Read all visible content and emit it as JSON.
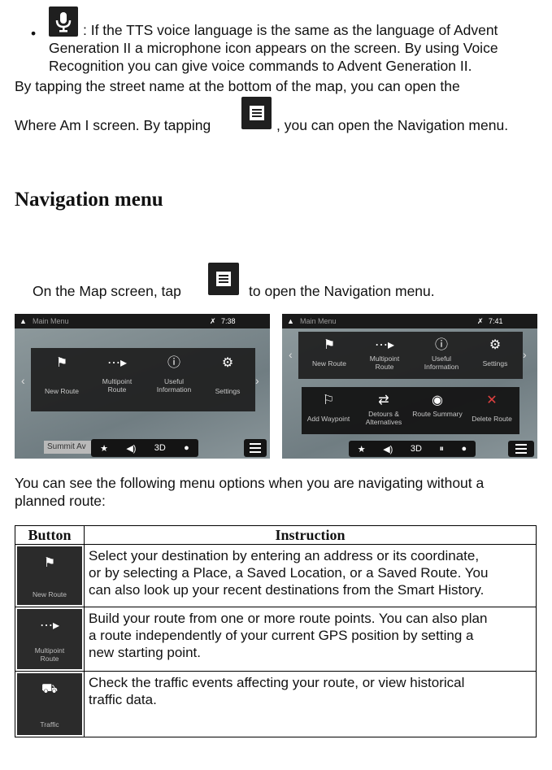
{
  "intro": {
    "bullet": "•",
    "mic_line1": ": If the TTS voice language is the same as the language of Advent",
    "mic_line2": "Generation II a microphone icon appears on the screen. By using Voice",
    "mic_line3": "Recognition you can give voice commands to Advent Generation II.",
    "street_line1": "By tapping the street name at the bottom of the map, you can open the",
    "street_line2a": "Where Am I screen. By tapping",
    "street_line2b": ", you can open the Navigation menu."
  },
  "section_title": "Navigation menu",
  "map_instruction_a": "On the Map screen, tap",
  "map_instruction_b": "to open the Navigation menu.",
  "screenshot_left": {
    "header": "Main Menu",
    "time": "7:38",
    "items": [
      {
        "icon": "flag-icon",
        "label": "New Route"
      },
      {
        "icon": "multipoint-icon",
        "label": "Multipoint Route"
      },
      {
        "icon": "info-icon",
        "label": "Useful Information"
      },
      {
        "icon": "gear-icon",
        "label": "Settings"
      }
    ],
    "street": "Summit Av",
    "bottom": {
      "mode": "3D"
    }
  },
  "screenshot_right": {
    "header": "Main Menu",
    "time": "7:41",
    "items": [
      {
        "icon": "flag-icon",
        "label": "New Route"
      },
      {
        "icon": "multipoint-icon",
        "label": "Multipoint Route"
      },
      {
        "icon": "info-icon",
        "label": "Useful Information"
      },
      {
        "icon": "gear-icon",
        "label": "Settings"
      }
    ],
    "sub_items": [
      {
        "icon": "waypoint-icon",
        "label": "Add Waypoint"
      },
      {
        "icon": "detour-icon",
        "label": "Detours & Alternatives"
      },
      {
        "icon": "route-summary-icon",
        "label": "Route Summary"
      },
      {
        "icon": "delete-route-icon",
        "label": "Delete Route"
      }
    ],
    "bottom": {
      "mode": "3D"
    }
  },
  "options_intro_1": "You can see the following menu options when you are navigating without a",
  "options_intro_2": "planned route:",
  "table": {
    "headers": [
      "Button",
      "Instruction"
    ],
    "rows": [
      {
        "button_label": "New Route",
        "icon": "flag-icon",
        "lines": [
          "Select your destination by entering an address or its coordinate,",
          "or by selecting a Place, a Saved Location, or a Saved Route. You",
          "can also look up your recent destinations from the Smart History."
        ]
      },
      {
        "button_label_1": "Multipoint",
        "button_label_2": "Route",
        "icon": "multipoint-icon",
        "lines": [
          "Build your route from one or more route points. You can also plan",
          "a route independently of your current GPS position by setting a",
          "new starting point."
        ]
      },
      {
        "button_label": "Traffic",
        "icon": "traffic-icon",
        "lines": [
          "Check the traffic events affecting your route,  or view historical",
          "traffic data."
        ]
      }
    ]
  }
}
